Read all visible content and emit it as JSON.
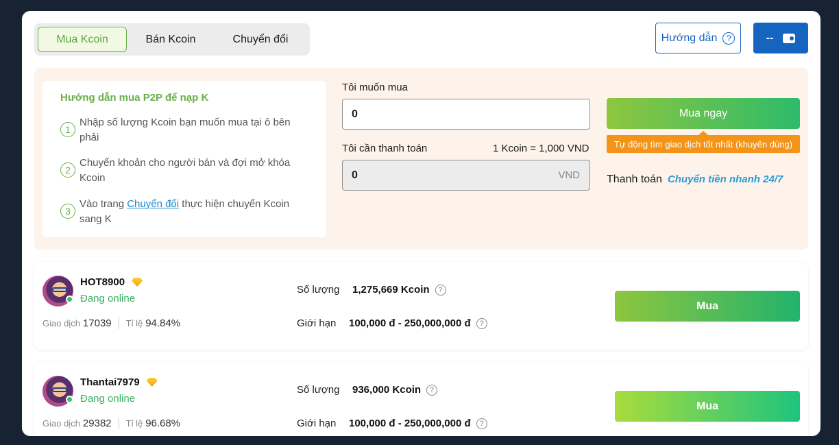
{
  "tabs": [
    "Mua Kcoin",
    "Bán Kcoin",
    "Chuyển đổi"
  ],
  "header": {
    "guide_label": "Hướng dẫn",
    "wallet_label": "--"
  },
  "guide": {
    "title": "Hướng dẫn mua P2P để nạp K",
    "steps": [
      {
        "num": "1",
        "text": "Nhập số lượng Kcoin bạn muốn mua tại ô bên phải"
      },
      {
        "num": "2",
        "text": "Chuyển khoản cho người bán và đợi mở khóa Kcoin"
      },
      {
        "num": "3",
        "pre": "Vào trang ",
        "link": "Chuyển đổi",
        "post": " thực hiện chuyển Kcoin sang K"
      }
    ]
  },
  "form": {
    "want_label": "Tôi muốn mua",
    "want_value": "0",
    "pay_label": "Tôi cần thanh toán",
    "rate": "1 Kcoin = 1,000 VND",
    "pay_value": "0",
    "pay_unit": "VND",
    "buy_now": "Mua ngay",
    "auto_tip": "Tự động tìm giao dịch tốt nhất (khuyên dùng)",
    "payment_label": "Thanh toán",
    "payment_method": "Chuyển tiền nhanh 24/7"
  },
  "sellers": [
    {
      "name": "HOT8900",
      "status": "Đang online",
      "trades_label": "Giao dịch",
      "trades": "17039",
      "rate_label": "Tỉ lệ",
      "rate": "94.84%",
      "qty_label": "Số lượng",
      "qty": "1,275,669 Kcoin",
      "limit_label": "Giới hạn",
      "limit": "100,000 đ - 250,000,000 đ",
      "buy_label": "Mua"
    },
    {
      "name": "Thantai7979",
      "status": "Đang online",
      "trades_label": "Giao dịch",
      "trades": "29382",
      "rate_label": "Tỉ lệ",
      "rate": "96.68%",
      "qty_label": "Số lượng",
      "qty": "936,000 Kcoin",
      "limit_label": "Giới hạn",
      "limit": "100,000 đ - 250,000,000 đ",
      "buy_label": "Mua"
    }
  ],
  "colors": {
    "accent_blue": "#1565c0",
    "green": "#6aae4a",
    "orange": "#f39419",
    "link": "#2a9bd8"
  }
}
